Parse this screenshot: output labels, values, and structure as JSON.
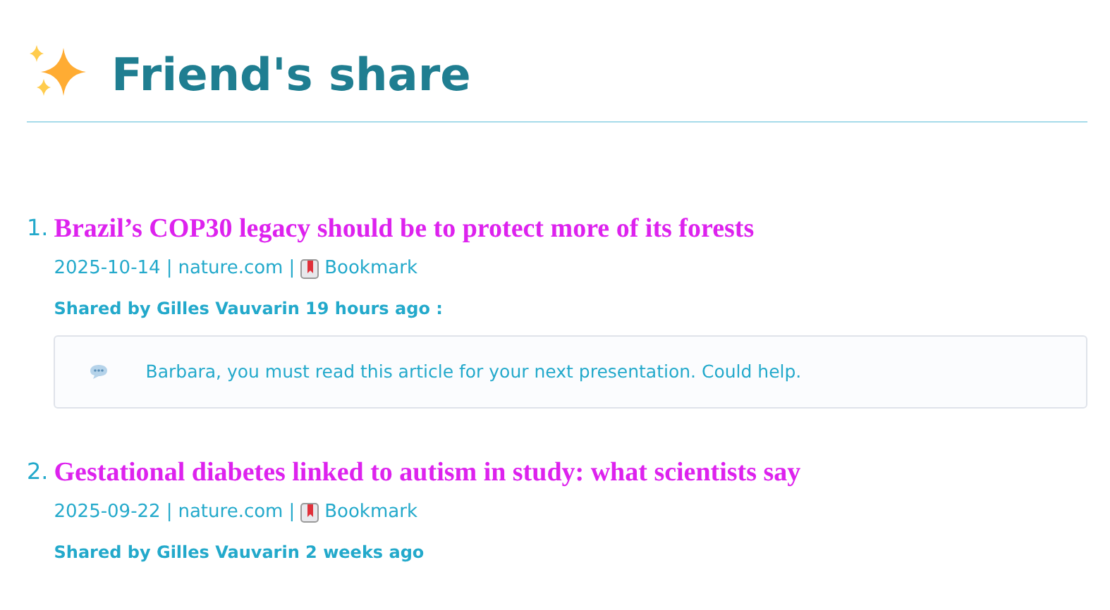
{
  "heading": "Friend's share",
  "articles": [
    {
      "number": "1.",
      "title": "Brazil’s COP30 legacy should be to protect more of its forests",
      "date": "2025-10-14",
      "separators": [
        "|",
        "|"
      ],
      "source": "nature.com",
      "bookmark": "Bookmark",
      "shared": "Shared by Gilles Vauvarin 19 hours ago :",
      "comment": "Barbara, you must read this article for your next presentation. Could help."
    },
    {
      "number": "2.",
      "title": "Gestational diabetes linked to autism in study: what scientists say",
      "date": "2025-09-22",
      "separators": [
        "|",
        "|"
      ],
      "source": "nature.com",
      "bookmark": "Bookmark",
      "shared": "Shared by Gilles Vauvarin 2 weeks ago"
    }
  ]
}
